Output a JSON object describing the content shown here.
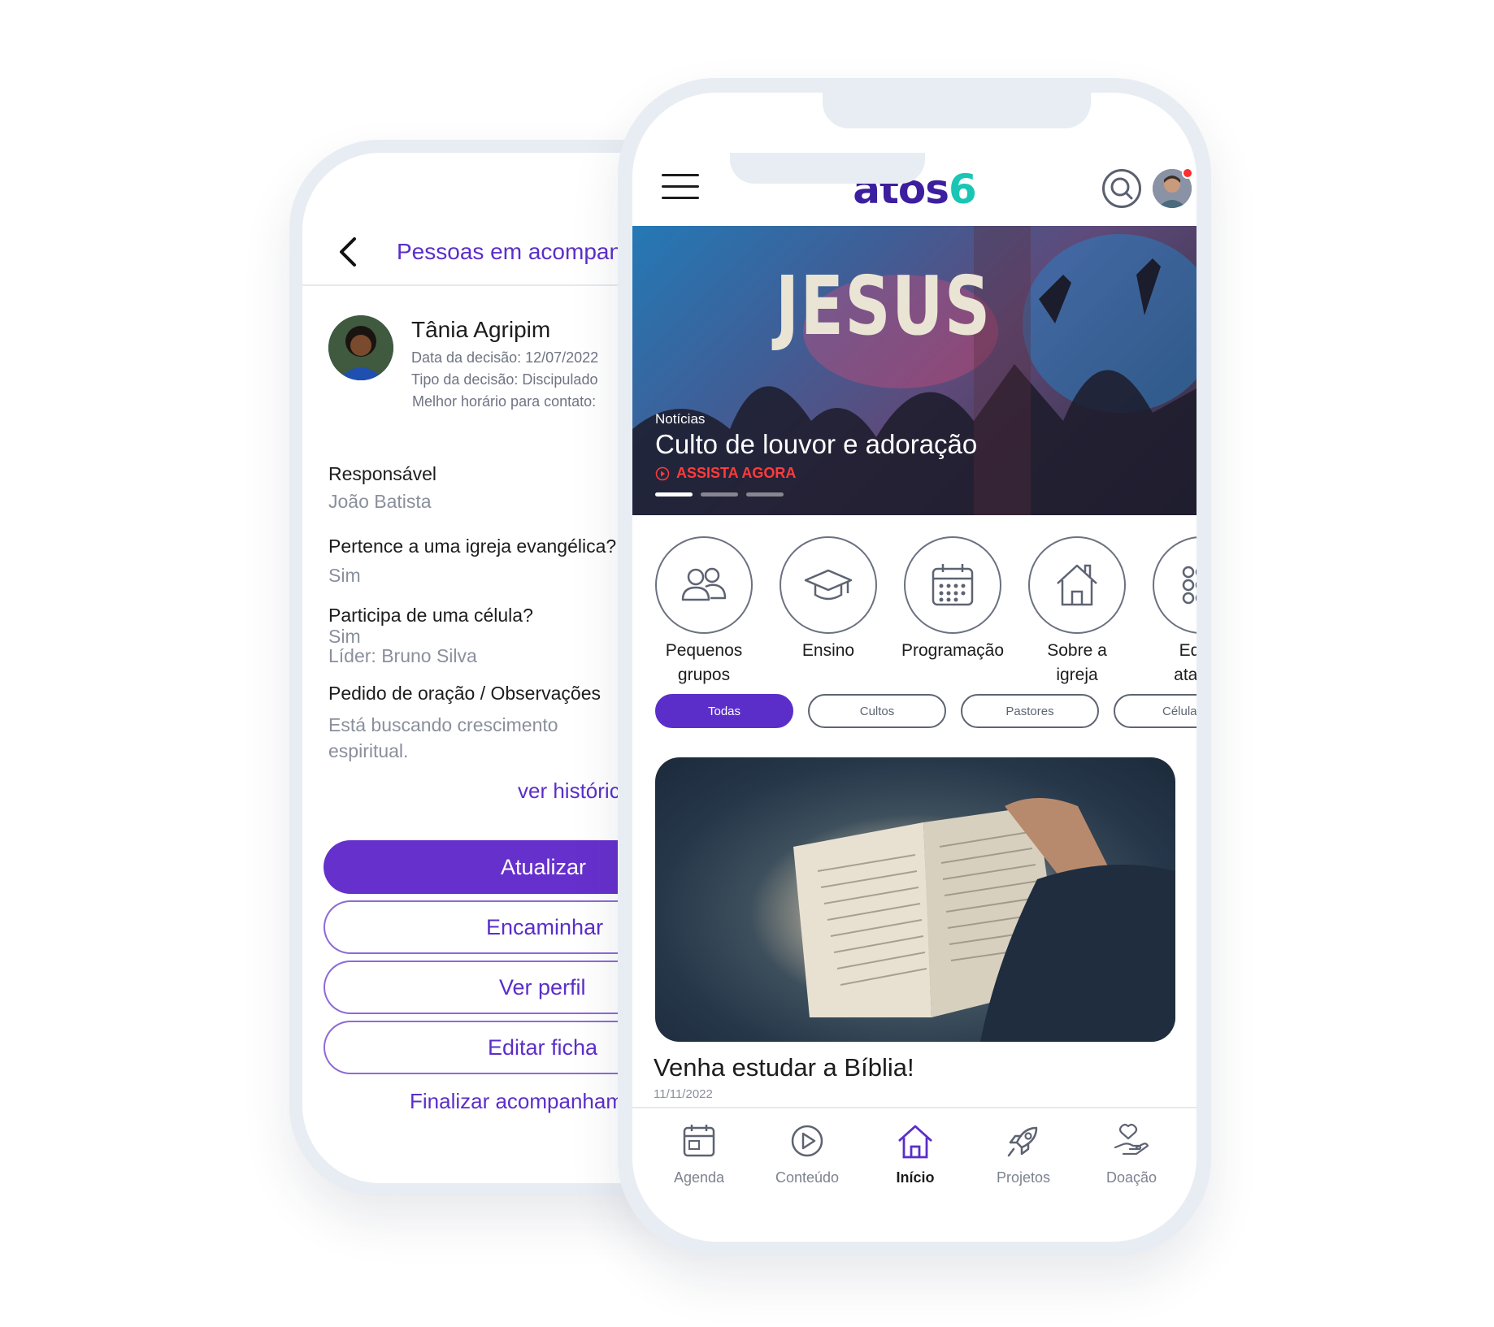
{
  "back_screen": {
    "header_title": "Pessoas em acompanhamento",
    "person": {
      "name": "Tânia Agripim",
      "decision_date": "Data da decisão: 12/07/2022",
      "decision_type": "Tipo da decisão: Discipulado",
      "contact_time": "Melhor horário para contato:"
    },
    "fields": [
      {
        "label": "Responsável",
        "value": "João Batista"
      },
      {
        "label": "Pertence a uma igreja evangélica?",
        "value": "Sim"
      },
      {
        "label": "Participa de uma célula?",
        "value": "Sim",
        "value2": "Líder: Bruno Silva"
      },
      {
        "label": "Pedido de oração / Observações",
        "value": "Está buscando crescimento",
        "value2": "espiritual."
      }
    ],
    "history_link": "ver histórico",
    "buttons": {
      "update": "Atualizar",
      "forward": "Encaminhar",
      "view_profile": "Ver perfil",
      "edit_form": "Editar ficha"
    },
    "finish_link": "Finalizar acompanhamento"
  },
  "front_screen": {
    "logo_text": "atos",
    "logo_accent": "6",
    "hero": {
      "image_word": "JESUS",
      "category": "Notícias",
      "title": "Culto de louvor e adoração",
      "cta": "ASSISTA AGORA"
    },
    "shortcuts": [
      {
        "label_line1": "Pequenos",
        "label_line2": "grupos",
        "icon": "group-icon"
      },
      {
        "label_line1": "Ensino",
        "label_line2": "",
        "icon": "graduation-cap-icon"
      },
      {
        "label_line1": "Programação",
        "label_line2": "",
        "icon": "calendar-icon"
      },
      {
        "label_line1": "Sobre a",
        "label_line2": "igreja",
        "icon": "church-house-icon"
      },
      {
        "label_line1": "Editar",
        "label_line2": "atalhos",
        "icon": "grid-dots-icon"
      }
    ],
    "filters": [
      "Todas",
      "Cultos",
      "Pastores",
      "Células"
    ],
    "active_filter": "Todas",
    "card": {
      "title": "Venha estudar a Bíblia!",
      "date": "11/11/2022"
    },
    "bottom_nav": [
      {
        "label": "Agenda",
        "icon": "agenda-icon"
      },
      {
        "label": "Conteúdo",
        "icon": "play-icon"
      },
      {
        "label": "Início",
        "icon": "home-icon"
      },
      {
        "label": "Projetos",
        "icon": "rocket-icon"
      },
      {
        "label": "Doação",
        "icon": "donation-hand-icon"
      }
    ],
    "active_nav": "Início"
  },
  "colors": {
    "brand_purple": "#5b2ec9",
    "button_purple": "#6630cc",
    "logo_teal": "#19c6b4",
    "alert_red": "#ff3b3b"
  }
}
